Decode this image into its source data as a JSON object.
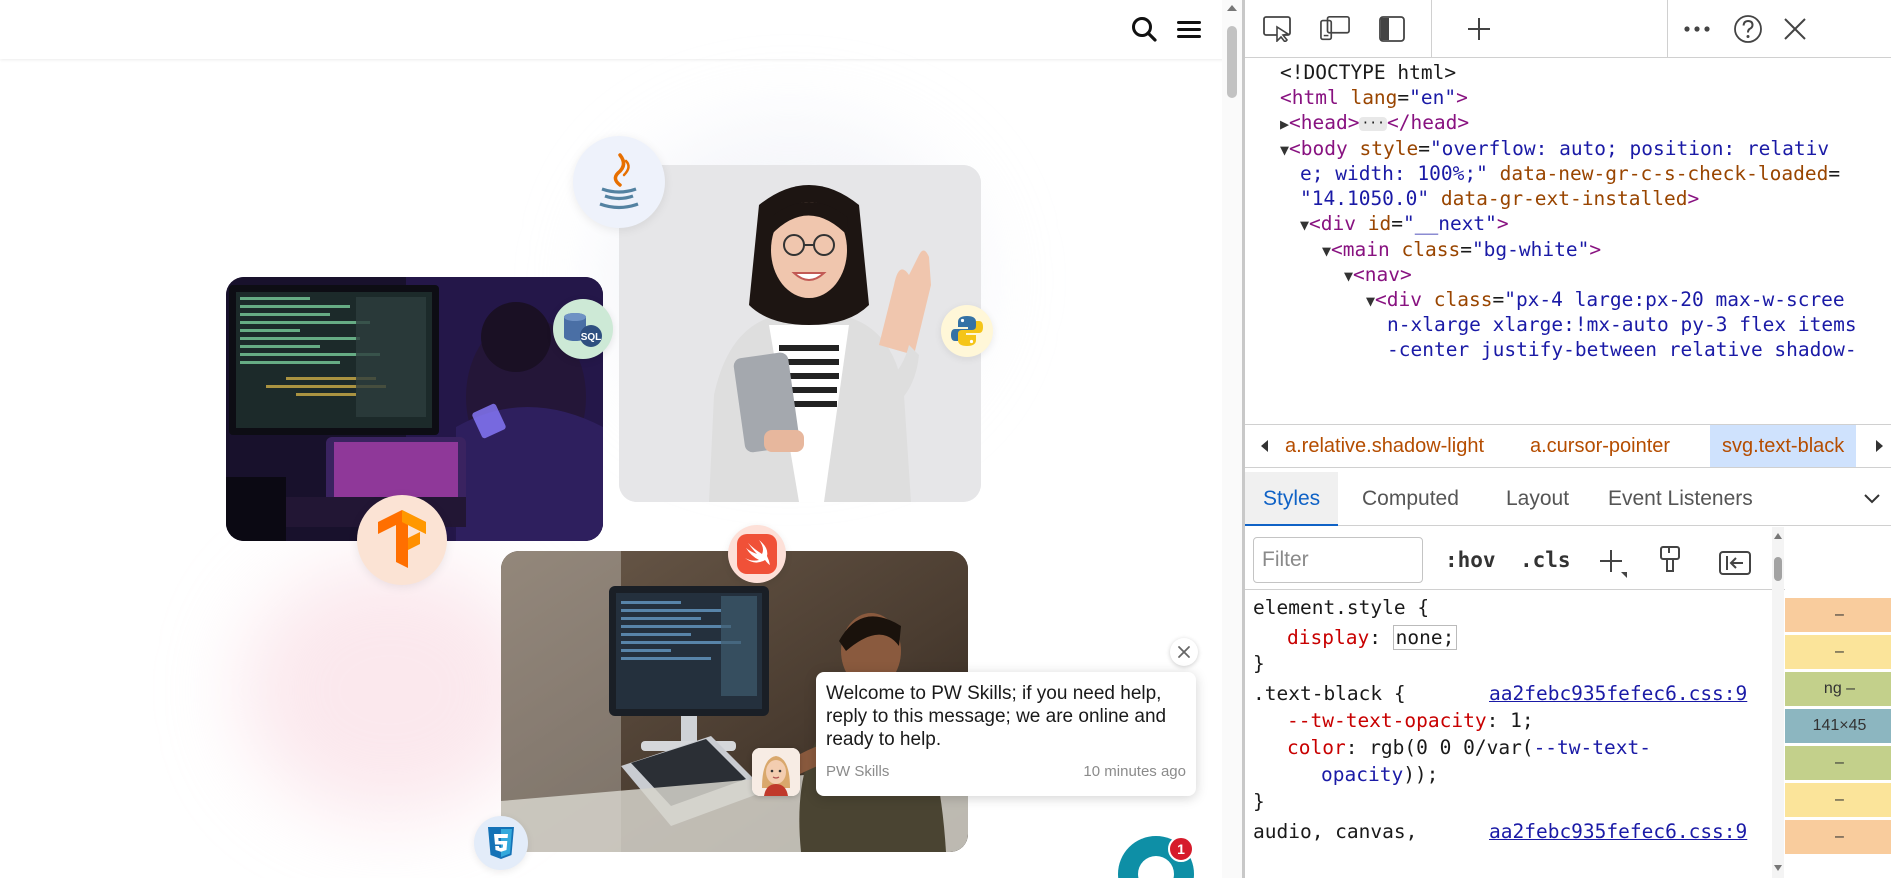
{
  "page": {
    "header_icons": [
      "search-icon",
      "menu-icon"
    ],
    "tech_bubbles": [
      "java-icon",
      "sql-icon",
      "python-icon",
      "tensorflow-icon",
      "swift-icon",
      "css3-icon"
    ],
    "chat": {
      "message": "Welcome to PW Skills; if you need help, reply to this message; we are online and ready to help.",
      "sender": "PW Skills",
      "time": "10 minutes ago",
      "badge_count": "1"
    }
  },
  "devtools": {
    "toolbar_icons": [
      "inspect-icon",
      "device-emulation-icon",
      "dock-side-icon",
      "new-tab-icon",
      "more-icon",
      "help-icon",
      "close-icon"
    ],
    "dom": {
      "doctype": "<!DOCTYPE html>",
      "html_open": "<html",
      "html_attr": "lang",
      "html_val": "\"en\"",
      "head_open": "<head>",
      "head_close": "</head>",
      "body_open": "<body",
      "body_attr": "style",
      "body_val_1": "\"overflow: auto; position: relativ",
      "body_val_2": "e; width: 100%;\"",
      "body_attr2": "data-new-gr-c-s-check-loaded",
      "body_val_3": "\"14.1050.0\"",
      "body_attr3": "data-gr-ext-installed",
      "div_open": "<div",
      "div_attr": "id",
      "div_val": "\"__next\"",
      "main_open": "<main",
      "main_attr": "class",
      "main_val": "\"bg-white\"",
      "nav_open": "<nav>",
      "div2_open": "<div",
      "div2_attr": "class",
      "div2_val_1": "\"px-4 large:px-20 max-w-scree",
      "div2_val_2": "n-xlarge xlarge:!mx-auto py-3 flex items",
      "div2_val_3": "-center justify-between relative shadow-"
    },
    "breadcrumbs": [
      "a.relative.shadow-light",
      "a.cursor-pointer",
      "svg.text-black"
    ],
    "tabs": [
      "Styles",
      "Computed",
      "Layout",
      "Event Listeners"
    ],
    "filter_placeholder": "Filter",
    "hov_label": ":hov",
    "cls_label": ".cls",
    "styles": {
      "element_style": "element.style {",
      "display_prop": "display",
      "display_val": "none;",
      "close_brace": "}",
      "rule1_selector": ".text-black {",
      "rule1_source": "aa2febc935fefec6.css:9",
      "rule1_prop1": "--tw-text-opacity",
      "rule1_val1": "1;",
      "rule1_prop2": "color",
      "rule1_val2a": "rgb(0 0 0/var(",
      "rule1_val2b": "--tw-text-",
      "rule1_val2c": "opacity",
      "rule1_val2d": "));",
      "rule2_selector": "audio, canvas,",
      "rule2_source": "aa2febc935fefec6.css:9"
    },
    "box_model": [
      "–",
      "–",
      "ng –",
      "141×45",
      "–",
      "–",
      "–"
    ]
  }
}
